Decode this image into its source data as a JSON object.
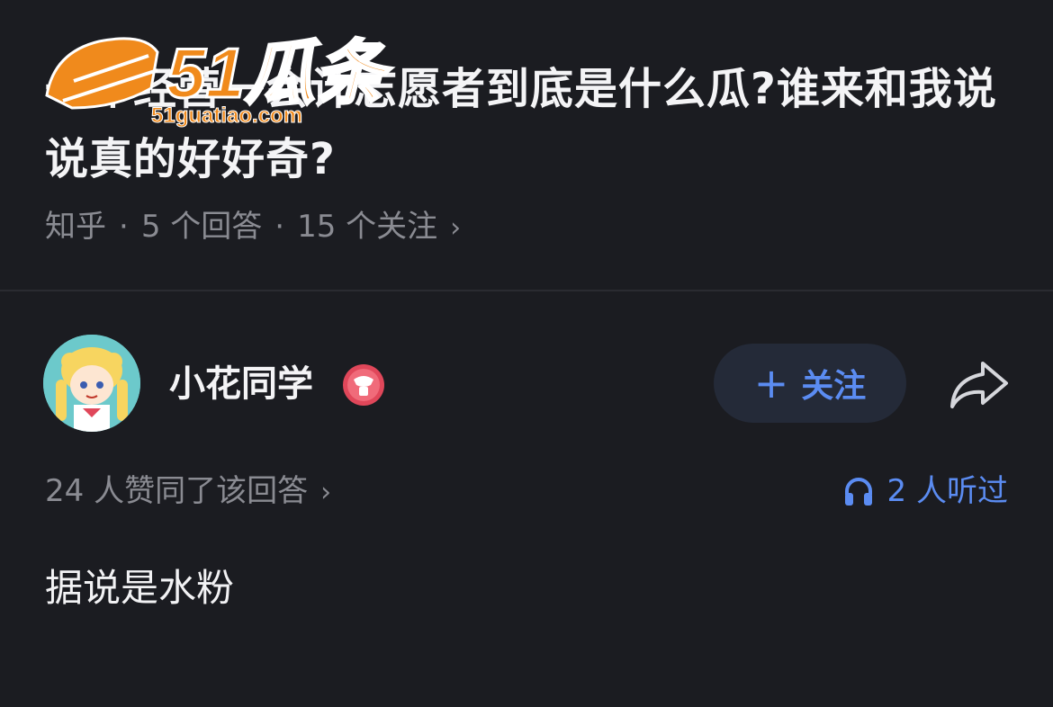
{
  "question": {
    "title": "一年经营一会计志愿者到底是什么瓜?谁来和我说说真的好好奇?",
    "source": "知乎",
    "answers": "5 个回答",
    "followers": "15 个关注",
    "separator": "·",
    "chevron": "›"
  },
  "watermark": {
    "brand": "51瓜条",
    "domain": "51guatiao.com",
    "color": "#f08a1c"
  },
  "author": {
    "name": "小花同学",
    "follow_label": "关注",
    "follow_plus": "+"
  },
  "stats": {
    "likes": "24 人赞同了该回答",
    "chevron": "›",
    "listened": "2 人听过"
  },
  "answer": {
    "text": "据说是水粉"
  },
  "colors": {
    "background": "#1b1c21",
    "accent": "#5b8cf2",
    "muted": "#8a8b92",
    "badge": "#e0475a"
  }
}
